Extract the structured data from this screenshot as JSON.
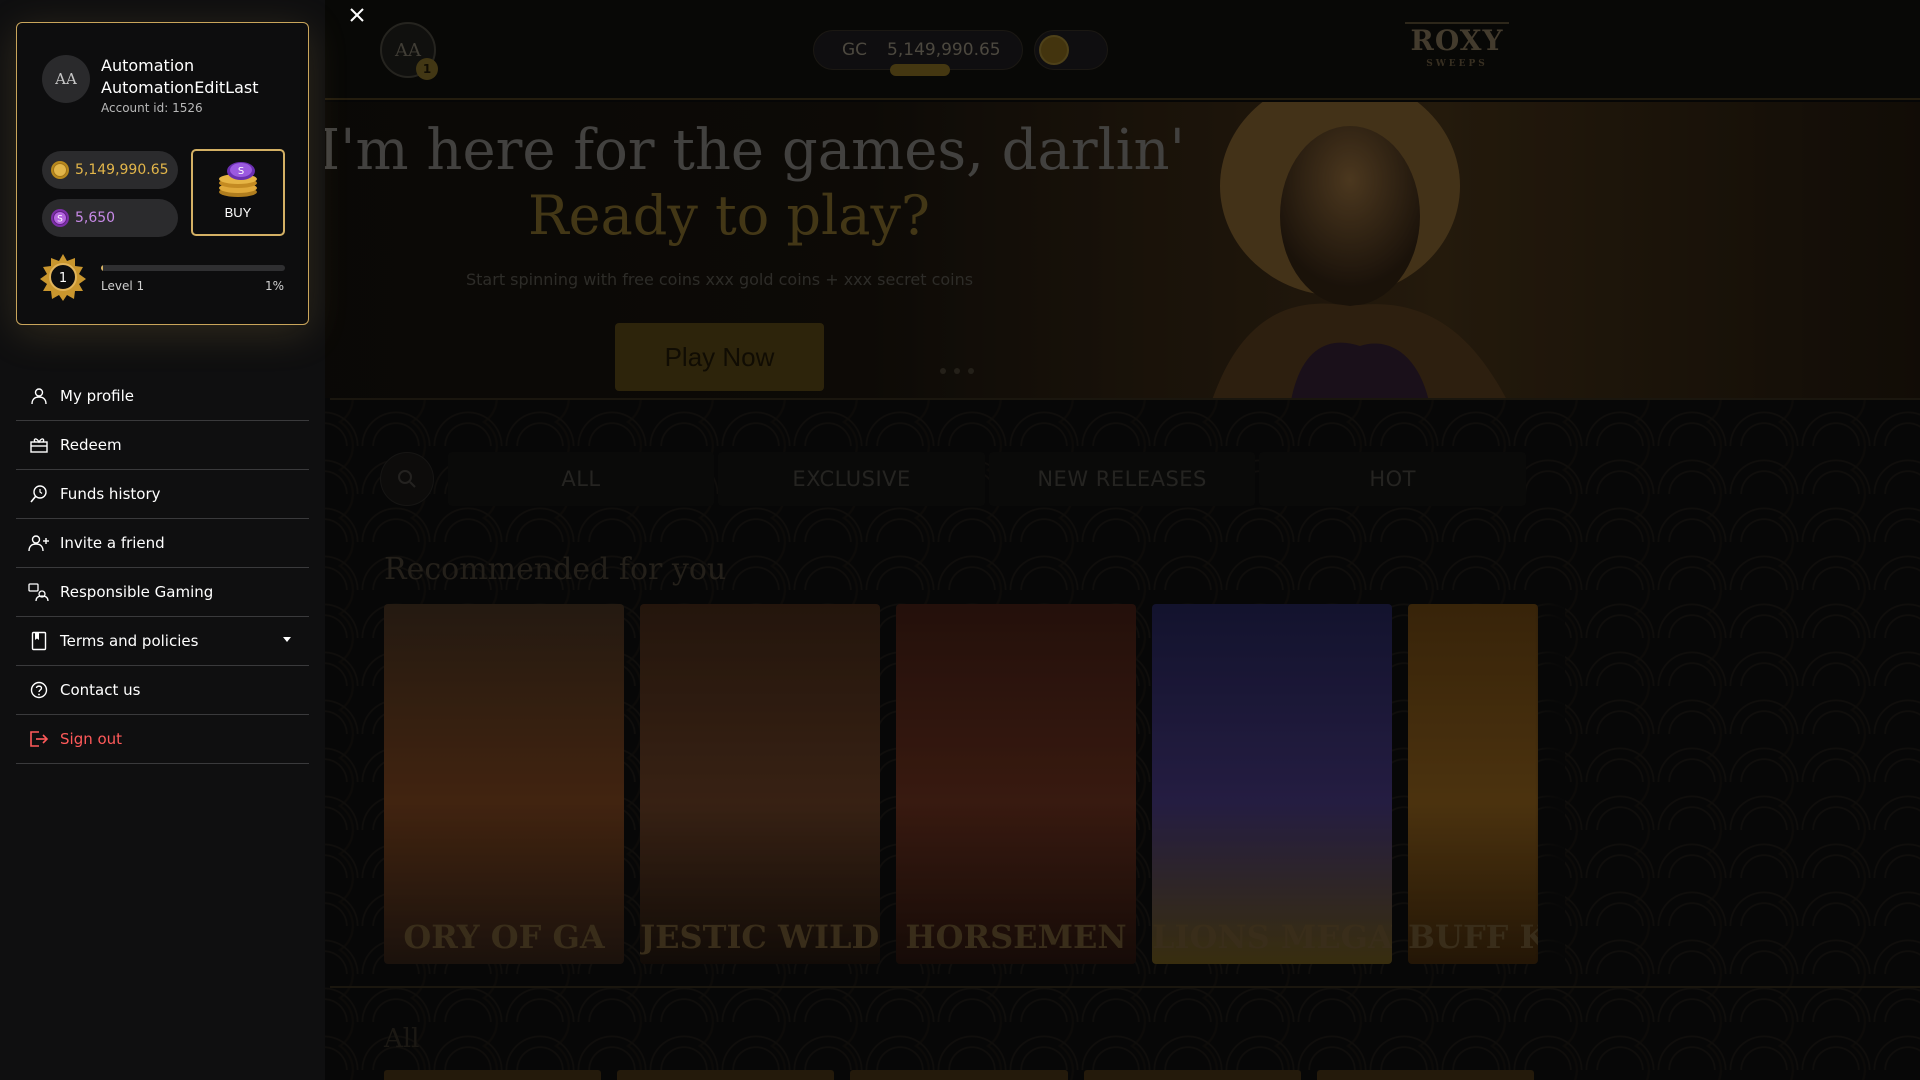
{
  "background_app": {
    "top_avatar_initials": "AA",
    "top_avatar_badge": "1",
    "balance_currency": "GC",
    "balance_amount": "5,149,990.65",
    "logo_text": "ROXY",
    "logo_sub": "SWEEPS",
    "hero": {
      "title": "I'm here for the games, darlin'",
      "subtitle": "Ready to play?",
      "description": "Start spinning with free coins xxx gold coins + xxx secret coins",
      "button": "Play Now"
    },
    "filter_tabs": [
      "ALL",
      "EXCLUSIVE",
      "NEW RELEASES",
      "HOT"
    ],
    "recommended_title": "Recommended for you",
    "games": [
      {
        "name": "ORY OF GA",
        "colors": [
          "#3b2a1c",
          "#6a3a1a",
          "#2c1d14"
        ]
      },
      {
        "name": "JESTIC WILD BUFFA",
        "colors": [
          "#3a2314",
          "#5a3620",
          "#1d130c"
        ]
      },
      {
        "name": "HORSEMEN",
        "colors": [
          "#3a1a12",
          "#5b2a1a",
          "#24120c"
        ]
      },
      {
        "name": "LIONS MEGAWAYS",
        "colors": [
          "#1f1f4a",
          "#3b2f6a",
          "#5b4a18"
        ]
      },
      {
        "name": "BUFF KI MEGA",
        "colors": [
          "#5a3a10",
          "#7a5218",
          "#3a240a"
        ]
      }
    ],
    "all_title": "All"
  },
  "drawer": {
    "profile": {
      "initials": "AA",
      "name": "Automation AutomationEditLast",
      "account_id": "Account id: 1526",
      "gold_coins": "5,149,990.65",
      "secret_coins": "5,650",
      "buy_label": "BUY",
      "level_number": "1",
      "level_label": "Level 1",
      "level_percent_text": "1%",
      "level_progress": 0.01
    },
    "menu": [
      {
        "label": "My profile",
        "icon": "user-icon"
      },
      {
        "label": "Redeem",
        "icon": "gift-icon"
      },
      {
        "label": "Funds history",
        "icon": "history-search-icon"
      },
      {
        "label": "Invite a friend",
        "icon": "invite-user-icon"
      },
      {
        "label": "Responsible Gaming",
        "icon": "responsible-gaming-icon"
      },
      {
        "label": "Terms and policies",
        "icon": "document-icon"
      },
      {
        "label": "Contact us",
        "icon": "help-circle-icon"
      },
      {
        "label": "Sign out",
        "icon": "sign-out-icon"
      }
    ]
  },
  "colors": {
    "gold_accent": "#c9a55b",
    "gold_coin": "#e3b64a",
    "secret_coin": "#c88ae8",
    "sign_out": "#ff5a5a",
    "drawer_bg": "#0f0f10"
  }
}
